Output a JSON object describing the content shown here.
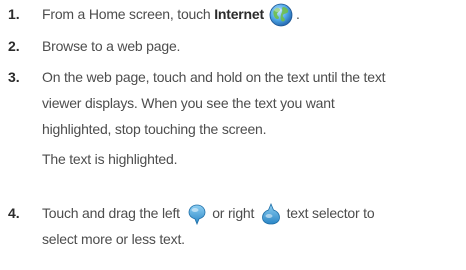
{
  "steps": [
    {
      "number": "1.",
      "text_before": "From a Home screen, touch ",
      "text_bold": "Internet",
      "text_after": ".",
      "icon": "internet-globe-icon"
    },
    {
      "number": "2.",
      "text": "Browse to a web page."
    },
    {
      "number": "3.",
      "lines": [
        "On the web page, touch and hold on the text until the text",
        "viewer displays. When you see the text you want",
        "highlighted, stop touching the screen."
      ],
      "result": "The text is highlighted."
    },
    {
      "number": "4.",
      "text_before": "Touch and drag the left ",
      "text_middle": " or right ",
      "text_after": " text selector to",
      "line2": "select more or less text.",
      "icons": [
        "left-text-selector-icon",
        "right-text-selector-icon"
      ]
    }
  ],
  "colors": {
    "body_text": "#4d4d4d",
    "number_text": "#2b2b2b",
    "selector_blue": "#3aa0d8",
    "globe_blue": "#2f7fc6"
  }
}
